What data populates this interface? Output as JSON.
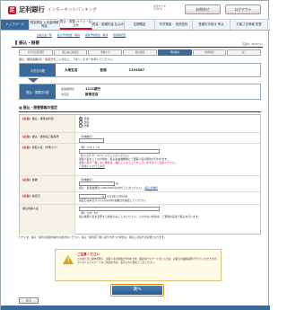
{
  "header": {
    "bank_name": "足利銀行",
    "service": "インターネットバンキング",
    "font_size_label": "文字サイズ",
    "font_size_options": "小 中 大",
    "buttons": [
      "お問合せ",
      "ログアウト"
    ]
  },
  "nav": {
    "items": [
      "トップページ",
      "残高照会\n入出金明細照会",
      "振込・振替\nペイジー払込み",
      "税金・各種料金\n払込み",
      "定期預金",
      "外貨預金・\n投資信託",
      "各種お手続き\n申込",
      "お客さま情報\n変更"
    ]
  },
  "subnav": [
    "お振込先一覧",
    "振込予約照会・取消",
    "振替予約照会・取消",
    "限度額変更"
  ],
  "page": {
    "title": "振込・振替",
    "page_id": "画面ID：IBKF0011"
  },
  "steps": [
    "お引出口座選択",
    "振込先口座指定",
    "金額入力",
    "振込振替",
    "登録確認",
    "内容確認",
    "完了"
  ],
  "instruction": "振込・振替金額(円)・指定日をご入力の上、「次へ」ボタンを押してください。",
  "source": {
    "label": "お引出口座",
    "branch": "大塚支店",
    "type": "普通",
    "number": "1234567"
  },
  "dest": {
    "label": "振込・振替先口座",
    "key1": "金融機関名",
    "key2": "支店名",
    "bank": "1111銀行",
    "branch": "新宿支店"
  },
  "section_title": "振込・振替情報の指定",
  "form": {
    "req": "[必須]",
    "r1_label": "振込・振替先科目",
    "r1_opts": [
      "普通",
      "当座",
      "貯蓄"
    ],
    "r2_label": "振込・振替先口座番号",
    "r2_hint": "（半角数字）",
    "r3_label": "受取人名（半角カナ）",
    "r3_hint": "（例）ｱｼｶｶﾞｷﾞﾝｺｳ",
    "r3_note1": "【ｶﾅ入力】ｶﾅ・ｱﾙﾌｧﾍﾞｯﾄでご入力ください。",
    "r3_note2": "受取人名をご入力の場合、振込先金融機関にて受取人名の照合が行われます。",
    "r3_note3": "受取人名が一致しない場合は、組戻しとなることがございますのでご注意ください。",
    "r3_link": "ご利用いただける文字",
    "r4_label": "金額",
    "r4_hint": "（半角数字）",
    "r4_unit": "円",
    "r4_note": "振込・振替金額は1,000,000円以内でご入力ください。",
    "r4_link": "振込手数料",
    "r5_label": "指定日",
    "r5_date": "2014年11月05日",
    "r5_note": "指定日は本日から1ヵ月以内の営業日を指定してください。",
    "r6_label": "振込依頼人名",
    "r6_hint": "（例）ｱｼｶｶﾞ ﾀﾛｳ",
    "r6_note": "振込依頼人名を変更する場合のみご入力ください。入力がない場合は、ご登録の名義で振込を行います。"
  },
  "note": "ただいま、振込・振替の指定内容をお確かめください。振込・振替完了後に誤りがあった場合は、組戻し手続きが必要となります。",
  "caution": {
    "title": "ご注意ください",
    "body": "このあとのご操作の際に、受取人名の照会が行われます。確認用パスワードのご入力は、お取引の最終段階で行っていただきます。ワンタイムパスワードをご利用の方は、表示された値をご入力ください。"
  },
  "buttons": {
    "next": "次へ",
    "back": "戻る"
  }
}
